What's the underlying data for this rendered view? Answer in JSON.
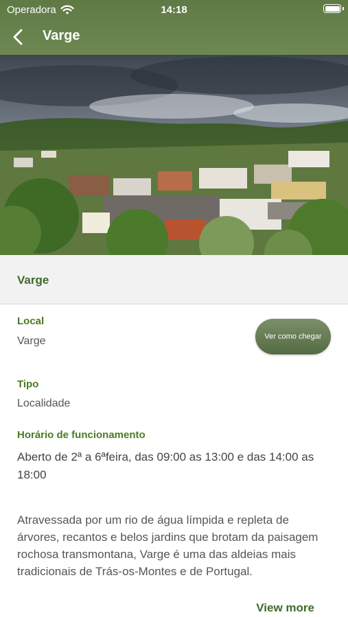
{
  "status_bar": {
    "carrier": "Operadora",
    "time": "14:18"
  },
  "nav": {
    "title": "Varge",
    "back_icon": "chevron-left-icon"
  },
  "hero": {
    "image": "village-landscape-photo"
  },
  "place": {
    "name": "Varge"
  },
  "details": {
    "local_label": "Local",
    "local_value": "Varge",
    "directions_label": "Ver como chegar",
    "tipo_label": "Tipo",
    "tipo_value": "Localidade",
    "hours_label": "Horário de funcionamento",
    "hours_value": "Aberto de 2ª a 6ªfeira, das 09:00 as 13:00 e das 14:00 as 18:00"
  },
  "description": {
    "text": "Atravessada por um rio de água límpida e repleta de árvores, recantos e belos jardins que brotam da paisagem rochosa transmontana, Varge é uma das aldeias mais tradicionais de Trás-os-Montes e de Portugal.",
    "view_more_label": "View more"
  },
  "colors": {
    "header": "#6d8852",
    "accent_text": "#4a7a25",
    "button": "#556b44"
  }
}
